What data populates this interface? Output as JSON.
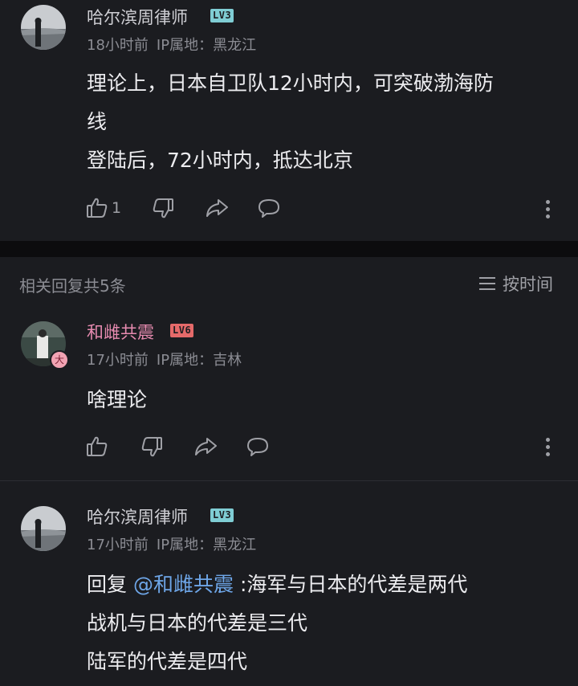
{
  "main_comment": {
    "username": "哈尔滨周律师",
    "level": "LV3",
    "time": "18小时前",
    "ip": "IP属地：黑龙江",
    "lines": [
      "理论上，日本自卫队12小时内，可突破渤海防",
      "线",
      "登陆后，72小时内，抵达北京"
    ],
    "like_count": "1"
  },
  "replies_header": {
    "label": "相关回复共5条",
    "sort_label": "按时间"
  },
  "replies": [
    {
      "username": "和雌共震",
      "level": "LV6",
      "badge": "大",
      "time": "17小时前",
      "ip": "IP属地：吉林",
      "lines": [
        "啥理论"
      ]
    },
    {
      "username": "哈尔滨周律师",
      "level": "LV3",
      "time": "17小时前",
      "ip": "IP属地：黑龙江",
      "reply_prefix": "回复",
      "mention": "@和雌共震",
      "first_line_rest": ":海军与日本的代差是两代",
      "lines": [
        "战机与日本的代差是三代",
        "陆军的代差是四代"
      ]
    }
  ],
  "icons": {
    "like": "thumbs-up-icon",
    "dislike": "thumbs-down-icon",
    "share": "share-icon",
    "comment": "comment-icon",
    "more": "more-vertical-icon",
    "sort": "sort-lines-icon"
  },
  "colors": {
    "background": "#1b1c20",
    "text": "#ececef",
    "meta": "#8b8c93",
    "mention": "#6ea6e8",
    "pink_name": "#e78bb0",
    "lv3": "#7fcdd4",
    "lv6": "#e56a6a"
  }
}
